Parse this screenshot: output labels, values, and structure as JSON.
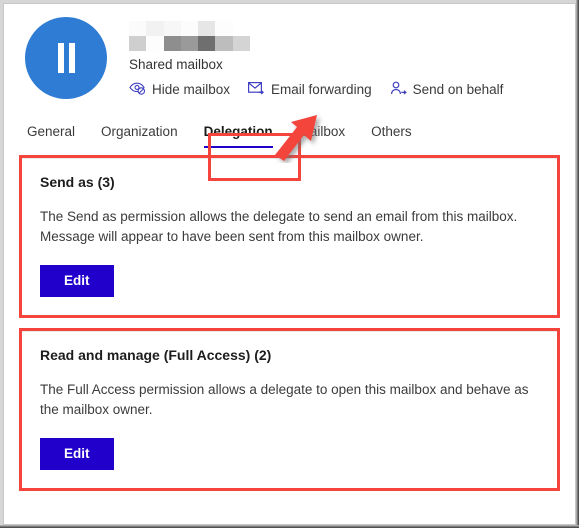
{
  "header": {
    "avatar": {
      "icon": "redacted-initials-avatar",
      "color": "#2f7cd4"
    },
    "display_name_redacted": true,
    "subtitle": "Shared mailbox",
    "actions": [
      {
        "label": "Hide mailbox",
        "icon": "hide-mailbox-icon"
      },
      {
        "label": "Email forwarding",
        "icon": "email-forwarding-icon"
      },
      {
        "label": "Send on behalf",
        "icon": "send-on-behalf-icon"
      }
    ]
  },
  "tabs": [
    {
      "label": "General",
      "active": false
    },
    {
      "label": "Organization",
      "active": false
    },
    {
      "label": "Delegation",
      "active": true
    },
    {
      "label": "Mailbox",
      "active": false
    },
    {
      "label": "Others",
      "active": false
    }
  ],
  "sections": [
    {
      "title": "Send as (3)",
      "description": "The Send as permission allows the delegate to send an email from this mailbox. Message will appear to have been sent from this mailbox owner.",
      "button_label": "Edit"
    },
    {
      "title": "Read and manage (Full Access) (2)",
      "description": "The Full Access permission allows a delegate to open this mailbox and behave as the mailbox owner.",
      "button_label": "Edit"
    }
  ],
  "annotations": {
    "highlight_color": "#f4443c",
    "arrow_color": "#f4443c",
    "arrow_points_to": "Delegation"
  },
  "colors": {
    "accent_blue": "#2200cc",
    "tab_underline": "#2200cc",
    "avatar_blue": "#2f7cd4",
    "icon_blue": "#4040c0",
    "text": "#3b3b3b"
  }
}
